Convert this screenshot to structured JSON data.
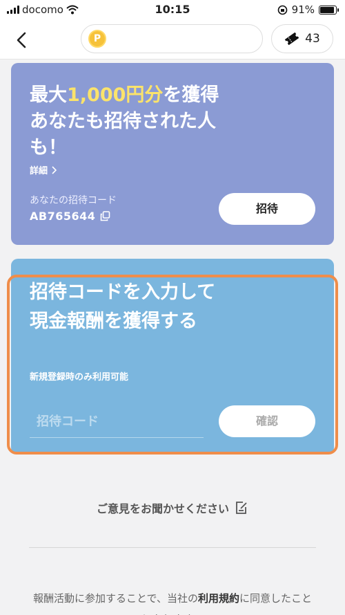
{
  "status_bar": {
    "carrier": "docomo",
    "time": "10:15",
    "battery": "91%",
    "battery_level": 0.91,
    "icons": [
      "signal-icon",
      "wifi-icon",
      "orientation-lock-icon",
      "battery-icon"
    ]
  },
  "nav": {
    "back_icon": "chevron-left-icon",
    "coin_icon": "p-coin-icon",
    "coin_glyph": "P",
    "ticket_icon": "ticket-icon",
    "ticket_count": "43"
  },
  "invite": {
    "headline_prefix": "最大",
    "headline_highlight": "1,000円分",
    "headline_suffix": "を獲得 あなたも招待された人も！",
    "details_label": "詳細",
    "code_label": "あなたの招待コード",
    "code_value": "AB765644",
    "invite_button": "招待",
    "colors": {
      "card": "#8b9bd4",
      "highlight": "#fbe36b"
    }
  },
  "enter_code": {
    "headline": "招待コードを入力して現金報酬を獲得する",
    "note": "新規登録時のみ利用可能",
    "input_placeholder": "招待コード",
    "confirm_button": "確認",
    "colors": {
      "card": "#7bb6de",
      "highlight_border": "#ef8d4a"
    }
  },
  "feedback": {
    "label": "ご意見をお聞かせください",
    "icon": "edit-note-icon"
  },
  "terms": {
    "prefix": "報酬活動に参加することで、当社の",
    "link": "利用規約",
    "suffix": "に同意したことになります。"
  }
}
